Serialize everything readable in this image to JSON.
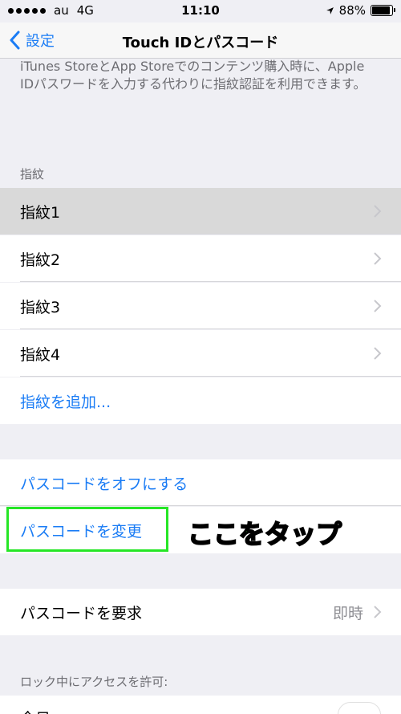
{
  "status_bar": {
    "carrier": "au",
    "network": "4G",
    "time": "11:10",
    "battery": "88%"
  },
  "nav": {
    "back_label": "設定",
    "title": "Touch IDとパスコード"
  },
  "description": "iTunes StoreとApp Storeでのコンテンツ購入時に、Apple IDパスワードを入力する代わりに指紋認証を利用できます。",
  "fingerprints": {
    "section_label": "指紋",
    "items": [
      {
        "label": "指紋1"
      },
      {
        "label": "指紋2"
      },
      {
        "label": "指紋3"
      },
      {
        "label": "指紋4"
      }
    ],
    "add_label": "指紋を追加..."
  },
  "passcode": {
    "turn_off_label": "パスコードをオフにする",
    "change_label": "パスコードを変更",
    "annotation": "ここをタップ"
  },
  "require": {
    "label": "パスコードを要求",
    "value": "即時"
  },
  "lock_access": {
    "section_label": "ロック中にアクセスを許可:",
    "first_item_label": "今日"
  },
  "colors": {
    "accent": "#1a7cf5",
    "annotation_green": "#2ee82e"
  }
}
